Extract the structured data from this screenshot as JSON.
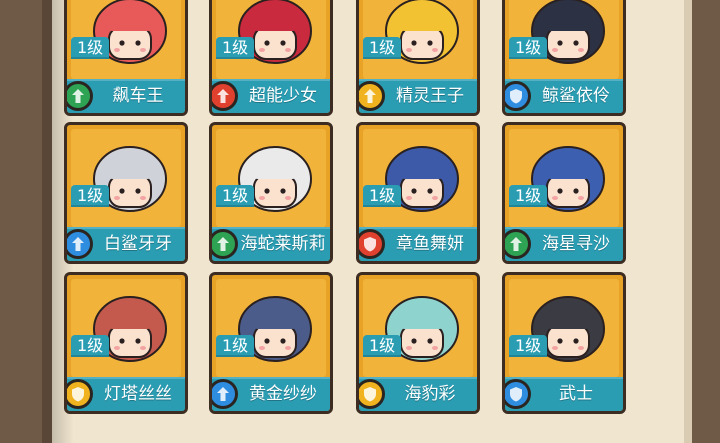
{
  "characters": [
    {
      "name": "飙车王",
      "level": "1级",
      "badge_color": "#2ea353",
      "badge_icon": "rank-up-icon",
      "hair": "#e85a5a"
    },
    {
      "name": "超能少女",
      "level": "1级",
      "badge_color": "#e0402e",
      "badge_icon": "rank-up-icon",
      "hair": "#c92a3e"
    },
    {
      "name": "精灵王子",
      "level": "1级",
      "badge_color": "#f0b21e",
      "badge_icon": "rank-up-icon",
      "hair": "#f2c233"
    },
    {
      "name": "鲸鲨依伶",
      "level": "1级",
      "badge_color": "#2f8de0",
      "badge_icon": "shield-icon",
      "hair": "#2c3144"
    },
    {
      "name": "白鲨牙牙",
      "level": "1级",
      "badge_color": "#2f8de0",
      "badge_icon": "rank-up-icon",
      "hair": "#cfd3d9"
    },
    {
      "name": "海蛇莱斯莉",
      "level": "1级",
      "badge_color": "#2ea353",
      "badge_icon": "rank-up-icon",
      "hair": "#eaeaea"
    },
    {
      "name": "章鱼舞妍",
      "level": "1级",
      "badge_color": "#e0402e",
      "badge_icon": "shield-icon",
      "hair": "#3c5aa8"
    },
    {
      "name": "海星寻沙",
      "level": "1级",
      "badge_color": "#2ea353",
      "badge_icon": "rank-up-icon",
      "hair": "#3d5fb0"
    },
    {
      "name": "灯塔丝丝",
      "level": "1级",
      "badge_color": "#f0b21e",
      "badge_icon": "shield-icon",
      "hair": "#c45a4e"
    },
    {
      "name": "黄金纱纱",
      "level": "1级",
      "badge_color": "#2f8de0",
      "badge_icon": "rank-up-icon",
      "hair": "#4b5c8a"
    },
    {
      "name": "海豹彩",
      "level": "1级",
      "badge_color": "#f0b21e",
      "badge_icon": "shield-icon",
      "hair": "#8fd3cf"
    },
    {
      "name": "武士",
      "level": "1级",
      "badge_color": "#2f8de0",
      "badge_icon": "shield-icon",
      "hair": "#3b3b44"
    }
  ]
}
